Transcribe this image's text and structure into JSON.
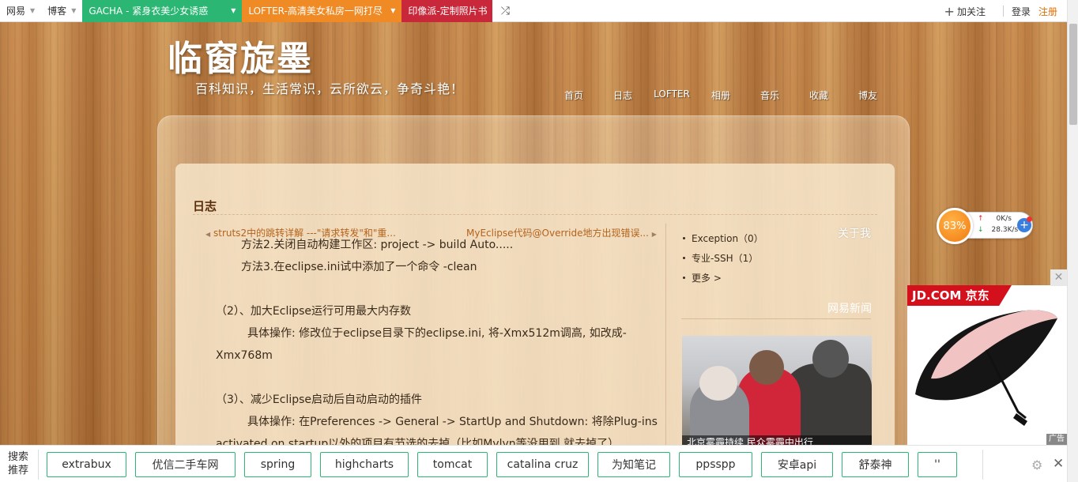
{
  "topbar": {
    "netease": "网易",
    "blog": "博客",
    "gacha": "GACHA - 紧身衣美少女诱惑",
    "lofter": "LOFTER-高清美女私房一网打尽",
    "yinxiang": "印像派-定制照片书",
    "follow": "加关注",
    "login": "登录",
    "register": "注册"
  },
  "header": {
    "title": "临窗旋墨",
    "subtitle": "百科知识，生活常识，云所欲云，争奇斗艳！",
    "nav": [
      "首页",
      "日志",
      "LOFTER",
      "相册",
      "音乐",
      "收藏",
      "博友"
    ]
  },
  "main": {
    "section_title": "日志",
    "prev_article": "struts2中的跳转详解 ---\"请求转发\"和\"重...",
    "next_article": "MyEclipse代码@Override地方出现错误...",
    "article_lines": [
      "方法2.关闭自动构建工作区: project -> build Auto.....",
      "方法3.在eclipse.ini试中添加了一个命令 -clean",
      "",
      "（2）、加大Eclipse运行可用最大内存数",
      "具体操作: 修改位于eclipse目录下的eclipse.ini, 将-Xmx512m调高, 如改成-",
      "Xmx768m",
      "",
      "（3）、减少Eclipse启动后自动启动的插件",
      "具体操作: 在Preferences -> General -> StartUp and Shutdown: 将除Plug-ins",
      "activated on startup以外的项目有节选的去掉（比如Mylyn等没用到,就去掉了）"
    ]
  },
  "sidebar": {
    "about_title": "关于我",
    "items": [
      "Exception（0）",
      "专业-SSH（1）",
      "更多 >"
    ],
    "news_title": "网易新闻",
    "news_caption": "北京雾霾持续 民众雾霾中出行"
  },
  "speed_widget": {
    "percent": "83%",
    "upload": "0K/s",
    "download": "28.3K/s"
  },
  "ad": {
    "brand": "JD.COM 京东",
    "tag": "广告"
  },
  "bottom_bar": {
    "label_1": "搜索",
    "label_2": "推荐",
    "tags": [
      "extrabux",
      "优信二手车网",
      "spring",
      "highcharts",
      "tomcat",
      "catalina cruz",
      "为知笔记",
      "ppsspp",
      "安卓api",
      "舒泰神",
      "''"
    ]
  },
  "colors": {
    "gacha": "#2bb673",
    "lofter": "#f08a24",
    "yinxiang": "#c8283a",
    "link": "#b4631c",
    "jd_red": "#d5101d"
  }
}
